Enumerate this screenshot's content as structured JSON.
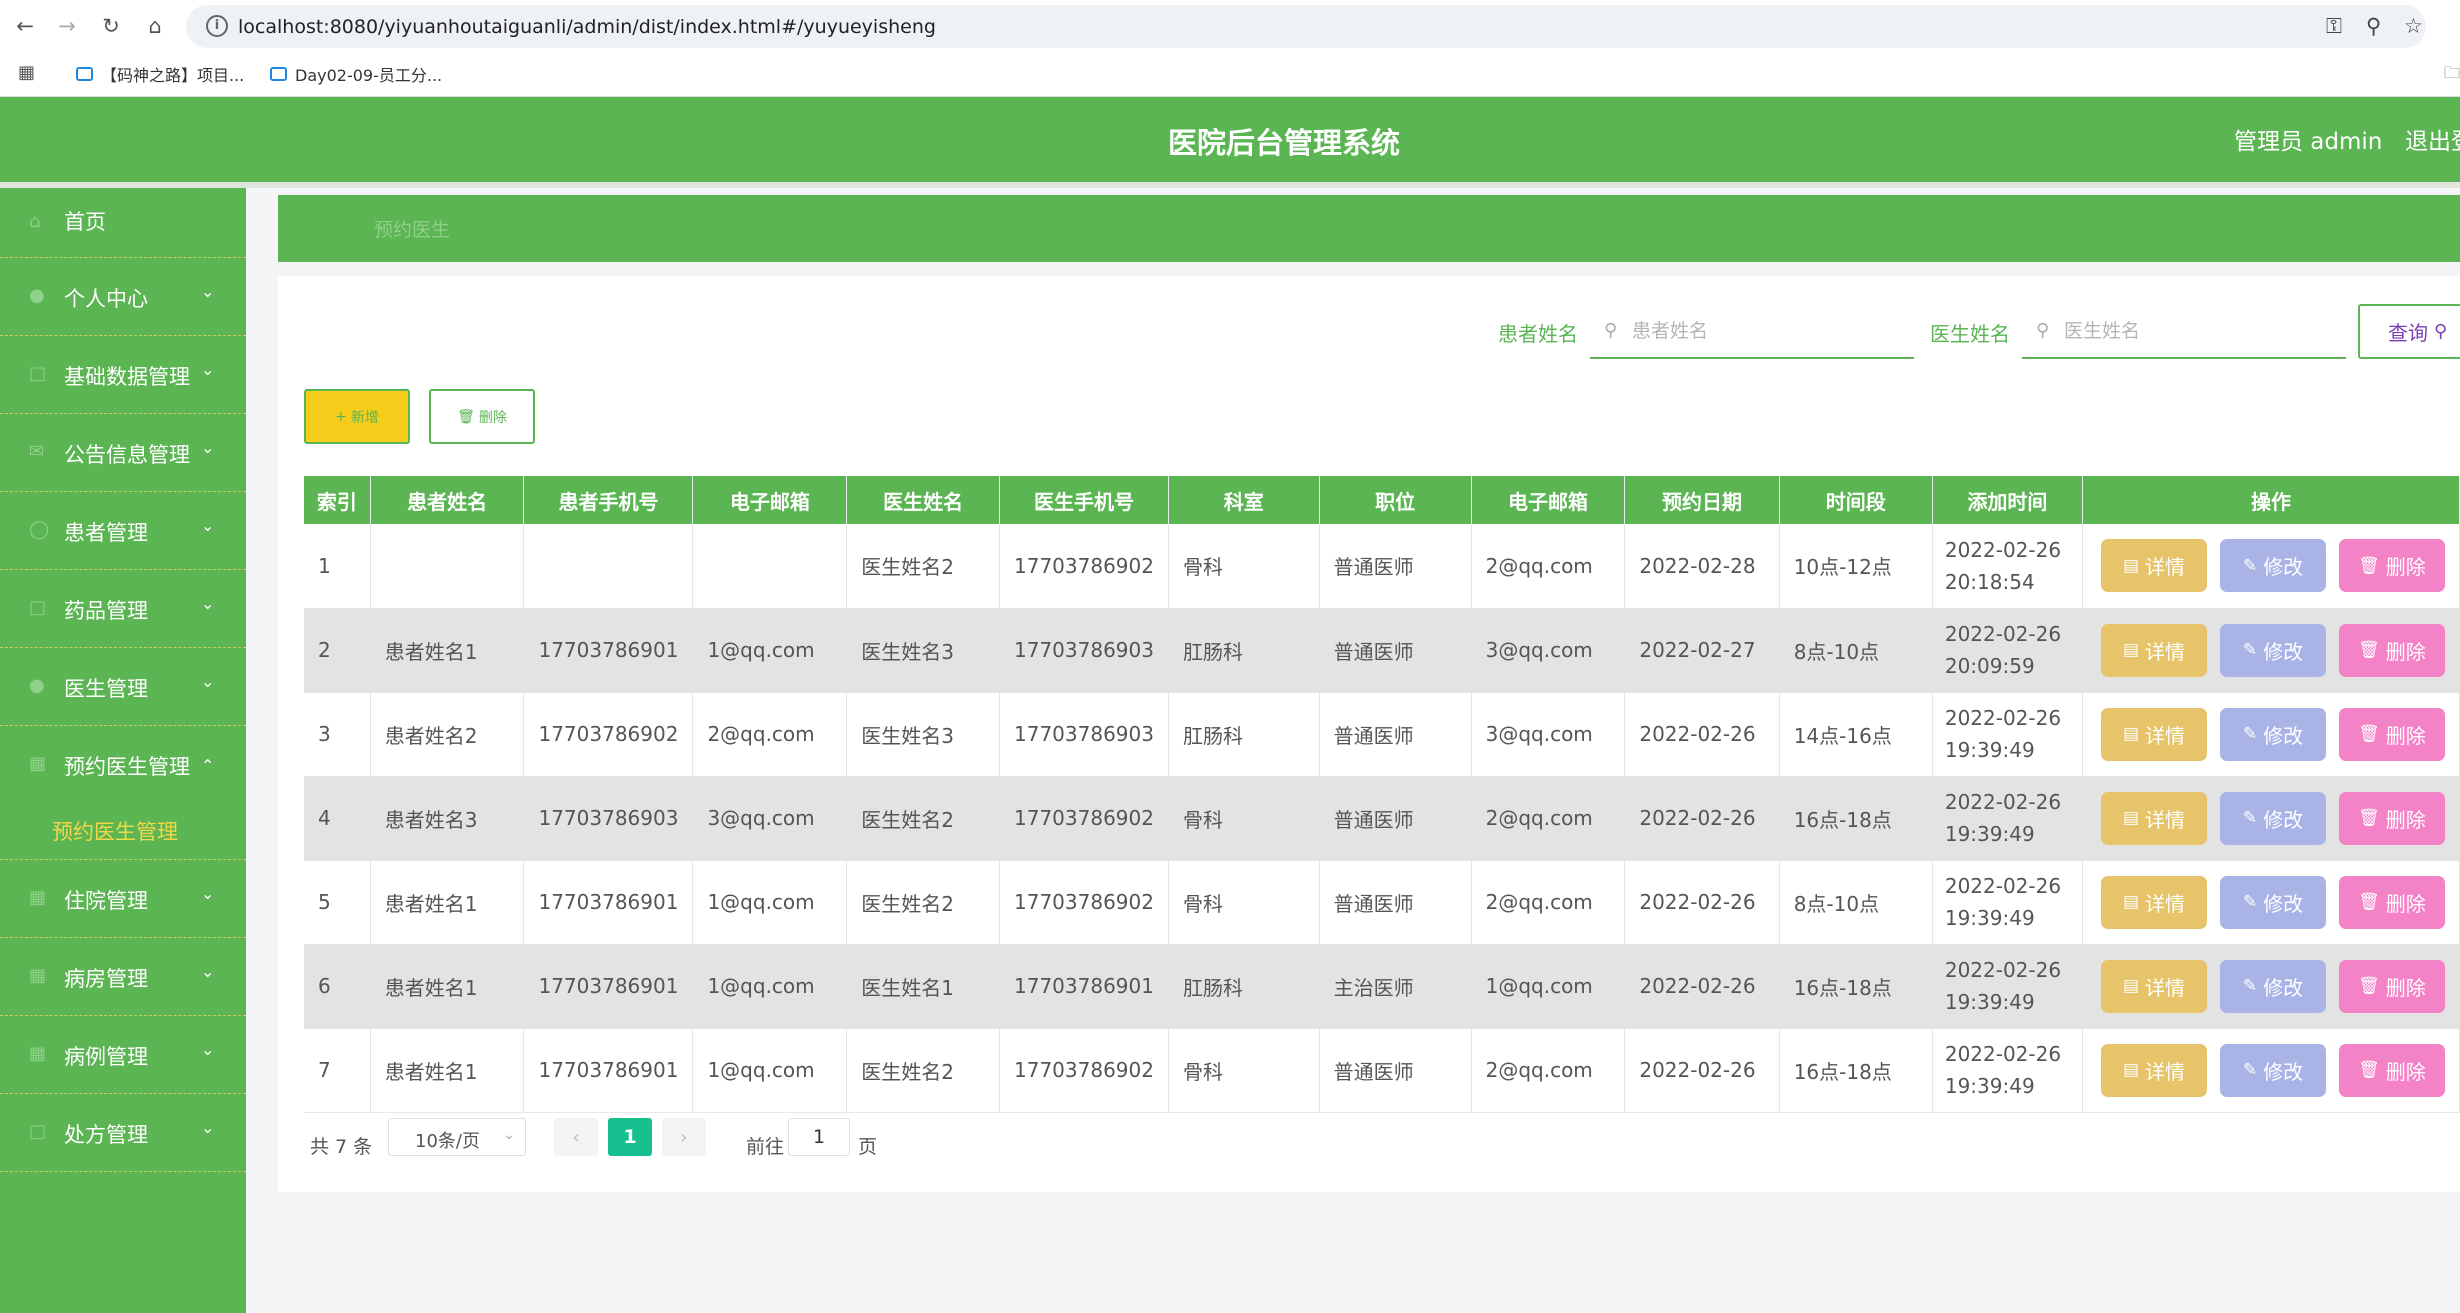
{
  "browser": {
    "url": "localhost:8080/yiyuanhoutaiguanli/admin/dist/index.html#/yuyueyisheng",
    "bookmarks": [
      {
        "label": "【码神之路】项目..."
      },
      {
        "label": "Day02-09-员工分..."
      }
    ]
  },
  "header": {
    "title": "医院后台管理系统",
    "admin_label": "管理员 admin",
    "logout_label": "退出登"
  },
  "sidebar": {
    "items": [
      {
        "label": "首页",
        "icon": "home-icon",
        "has_arrow": false
      },
      {
        "label": "个人中心",
        "icon": "user-icon",
        "has_arrow": true
      },
      {
        "label": "基础数据管理",
        "icon": "folder-icon",
        "has_arrow": true
      },
      {
        "label": "公告信息管理",
        "icon": "notice-icon",
        "has_arrow": true
      },
      {
        "label": "患者管理",
        "icon": "patient-icon",
        "has_arrow": true
      },
      {
        "label": "药品管理",
        "icon": "medicine-icon",
        "has_arrow": true
      },
      {
        "label": "医生管理",
        "icon": "doctor-icon",
        "has_arrow": true
      },
      {
        "label": "预约医生管理",
        "icon": "appointment-icon",
        "has_arrow": true,
        "expanded": true
      },
      {
        "label": "住院管理",
        "icon": "hospital-icon",
        "has_arrow": true
      },
      {
        "label": "病房管理",
        "icon": "ward-icon",
        "has_arrow": true
      },
      {
        "label": "病例管理",
        "icon": "case-icon",
        "has_arrow": true
      },
      {
        "label": "处方管理",
        "icon": "prescription-icon",
        "has_arrow": true
      }
    ],
    "sub_item": "预约医生管理"
  },
  "breadcrumb": "预约医生",
  "search": {
    "patient_label": "患者姓名",
    "patient_placeholder": "患者姓名",
    "doctor_label": "医生姓名",
    "doctor_placeholder": "医生姓名",
    "query_label": "查询"
  },
  "actions": {
    "add_label": "新增",
    "delete_label": "删除"
  },
  "table": {
    "headers": [
      "索引",
      "患者姓名",
      "患者手机号",
      "电子邮箱",
      "医生姓名",
      "医生手机号",
      "科室",
      "职位",
      "电子邮箱",
      "预约日期",
      "时间段",
      "添加时间",
      "操作"
    ],
    "rows": [
      [
        "1",
        "",
        "",
        "",
        "医生姓名2",
        "17703786902",
        "骨科",
        "普通医师",
        "2@qq.com",
        "2022-02-28",
        "10点-12点",
        "2022-02-26 20:18:54"
      ],
      [
        "2",
        "患者姓名1",
        "17703786901",
        "1@qq.com",
        "医生姓名3",
        "17703786903",
        "肛肠科",
        "普通医师",
        "3@qq.com",
        "2022-02-27",
        "8点-10点",
        "2022-02-26 20:09:59"
      ],
      [
        "3",
        "患者姓名2",
        "17703786902",
        "2@qq.com",
        "医生姓名3",
        "17703786903",
        "肛肠科",
        "普通医师",
        "3@qq.com",
        "2022-02-26",
        "14点-16点",
        "2022-02-26 19:39:49"
      ],
      [
        "4",
        "患者姓名3",
        "17703786903",
        "3@qq.com",
        "医生姓名2",
        "17703786902",
        "骨科",
        "普通医师",
        "2@qq.com",
        "2022-02-26",
        "16点-18点",
        "2022-02-26 19:39:49"
      ],
      [
        "5",
        "患者姓名1",
        "17703786901",
        "1@qq.com",
        "医生姓名2",
        "17703786902",
        "骨科",
        "普通医师",
        "2@qq.com",
        "2022-02-26",
        "8点-10点",
        "2022-02-26 19:39:49"
      ],
      [
        "6",
        "患者姓名1",
        "17703786901",
        "1@qq.com",
        "医生姓名1",
        "17703786901",
        "肛肠科",
        "主治医师",
        "1@qq.com",
        "2022-02-26",
        "16点-18点",
        "2022-02-26 19:39:49"
      ],
      [
        "7",
        "患者姓名1",
        "17703786901",
        "1@qq.com",
        "医生姓名2",
        "17703786902",
        "骨科",
        "普通医师",
        "2@qq.com",
        "2022-02-26",
        "16点-18点",
        "2022-02-26 19:39:49"
      ]
    ],
    "op_labels": {
      "detail": "详情",
      "edit": "修改",
      "delete": "删除"
    }
  },
  "pagination": {
    "total": "共 7 条",
    "page_size": "10条/页",
    "current_page": "1",
    "goto_label": "前往",
    "goto_value": "1",
    "goto_suffix": "页"
  },
  "colors": {
    "primary": "#5ab552",
    "add_button": "#f7cd1c",
    "detail_button": "#e7c36a",
    "edit_button": "#a9b3e6",
    "delete_button": "#f482c7",
    "active_page": "#16c08f",
    "sub_menu_text": "#f2d74a"
  }
}
